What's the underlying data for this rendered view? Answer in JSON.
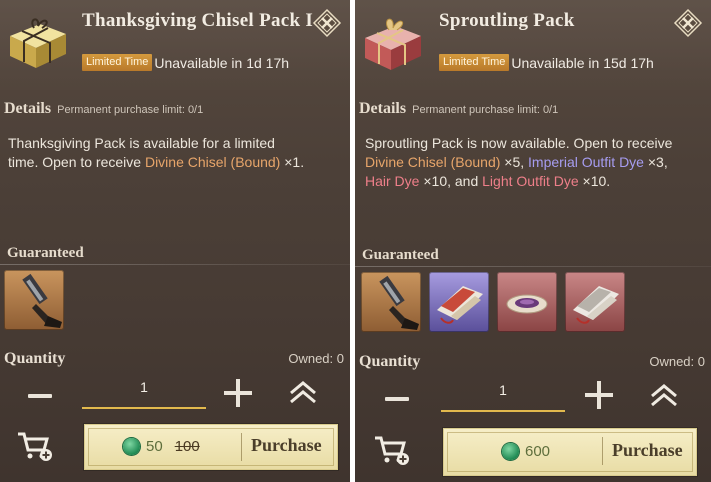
{
  "left_panel": {
    "title": "Thanksgiving Chisel Pack I",
    "badge": "Limited Time",
    "availability": "Unavailable in 1d 17h",
    "details_label": "Details",
    "purchase_limit": "Permanent purchase limit: 0/1",
    "description": {
      "p1": "Thanksgiving Pack is available for a limited time. Open to receive ",
      "item1": "Divine Chisel (Bound)",
      "q1": " ×1."
    },
    "guaranteed_label": "Guaranteed",
    "items": [
      {
        "name": "Divine Chisel (Bound)",
        "rarity": "orange",
        "icon": "chisel-icon"
      }
    ],
    "quantity_label": "Quantity",
    "owned": "Owned: 0",
    "quantity_value": "1",
    "price_now": "50",
    "price_old": "100",
    "purchase_label": "Purchase"
  },
  "right_panel": {
    "title": "Sproutling Pack",
    "badge": "Limited Time",
    "availability": "Unavailable in 15d 17h",
    "details_label": "Details",
    "purchase_limit": "Permanent purchase limit: 0/1",
    "description": {
      "p1": "Sproutling Pack is now available. Open to receive ",
      "item1": "Divine Chisel (Bound)",
      "q1": " ×5, ",
      "item2": "Imperial Outfit Dye",
      "q2": " ×3, ",
      "item3": "Hair Dye",
      "q3": " ×10, and ",
      "item4": "Light Outfit Dye",
      "q4": " ×10."
    },
    "guaranteed_label": "Guaranteed",
    "items": [
      {
        "name": "Divine Chisel (Bound)",
        "rarity": "orange",
        "icon": "chisel-icon"
      },
      {
        "name": "Imperial Outfit Dye",
        "rarity": "purple",
        "icon": "dye-cloth-icon"
      },
      {
        "name": "Hair Dye",
        "rarity": "red",
        "icon": "hair-dye-dish-icon"
      },
      {
        "name": "Light Outfit Dye",
        "rarity": "red",
        "icon": "dye-cloth-icon"
      }
    ],
    "quantity_label": "Quantity",
    "owned": "Owned: 0",
    "quantity_value": "1",
    "price_now": "600",
    "purchase_label": "Purchase"
  },
  "colors": {
    "badge": "#c9893a",
    "highlight_orange": "#e7a56a",
    "highlight_purple": "#a69cf0",
    "highlight_pink": "#ee7f8a",
    "currency": "#1f8a53"
  }
}
